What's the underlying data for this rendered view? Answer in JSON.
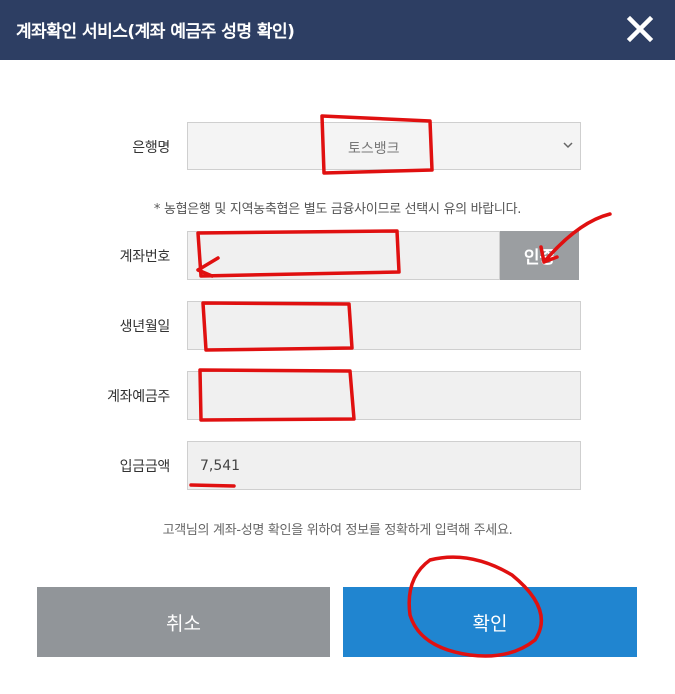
{
  "header": {
    "title": "계좌확인 서비스(계좌 예금주 성명 확인)",
    "close_icon": "close-icon"
  },
  "form": {
    "bank": {
      "label": "은행명",
      "selected": "토스뱅크"
    },
    "notice": "* 농협은행 및 지역농축협은 별도 금융사이므로 선택시 유의 바랍니다.",
    "account": {
      "label": "계좌번호",
      "value": "",
      "auth_button": "인증"
    },
    "birthdate": {
      "label": "생년월일",
      "value": ""
    },
    "holder": {
      "label": "계좌예금주",
      "value": ""
    },
    "amount": {
      "label": "입금금액",
      "value": "7,541"
    },
    "hint": "고객님의 계좌-성명 확인을 위하여 정보를 정확하게 입력해 주세요."
  },
  "buttons": {
    "cancel": "취소",
    "confirm": "확인"
  },
  "colors": {
    "header_bg": "#2d3e63",
    "confirm_bg": "#2085d0",
    "cancel_bg": "#919599",
    "annotation": "#e01010"
  }
}
